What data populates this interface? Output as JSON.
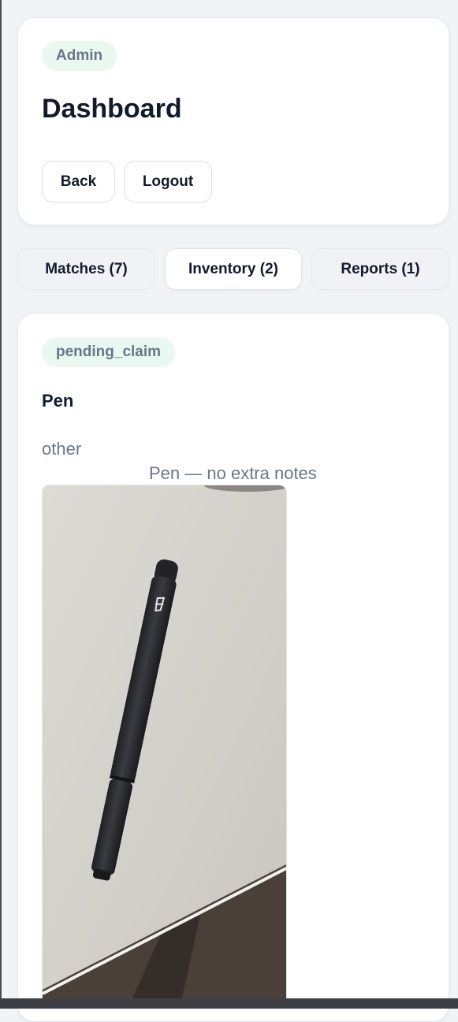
{
  "header": {
    "role_badge": "Admin",
    "title": "Dashboard",
    "back_label": "Back",
    "logout_label": "Logout"
  },
  "tabs": [
    {
      "label": "Matches (7)",
      "active": false
    },
    {
      "label": "Inventory (2)",
      "active": true
    },
    {
      "label": "Reports (1)",
      "active": false
    }
  ],
  "item": {
    "status": "pending_claim",
    "name": "Pen",
    "category": "other",
    "notes": "Pen — no extra notes",
    "photo_icon": "pen-photo"
  },
  "colors": {
    "badge_bg": "#e9f8f0",
    "badge_text": "#6b7687",
    "title_text": "#121a2b",
    "muted_text": "#6b7687"
  }
}
